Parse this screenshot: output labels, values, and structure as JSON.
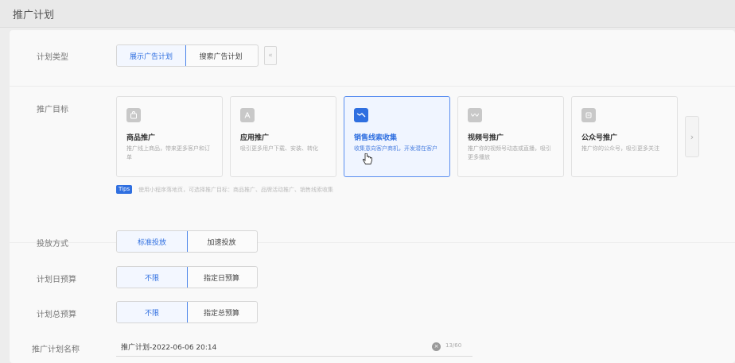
{
  "page": {
    "title": "推广计划"
  },
  "plan_type": {
    "label": "计划类型",
    "options": [
      "展示广告计划",
      "搜索广告计划"
    ],
    "selected": "展示广告计划",
    "collapse_glyph": "«"
  },
  "goal": {
    "label": "推广目标",
    "cards": [
      {
        "title": "商品推广",
        "desc": "推广线上商品，带来更多客户和订单",
        "icon": "shopping-bag-icon"
      },
      {
        "title": "应用推广",
        "desc": "吸引更多用户下载、安装、转化",
        "icon": "app-store-icon"
      },
      {
        "title": "销售线索收集",
        "desc": "收集意向客户商机，开发潜在客户",
        "icon": "sales-leads-icon"
      },
      {
        "title": "视频号推广",
        "desc": "推广你的视频号动态或直播，吸引更多播放",
        "icon": "video-channel-icon"
      },
      {
        "title": "公众号推广",
        "desc": "推广你的公众号，吸引更多关注",
        "icon": "official-account-icon"
      }
    ],
    "selected": "销售线索收集",
    "next_glyph": "›"
  },
  "tips": {
    "tag": "Tips",
    "text": "使用小程序落地页，可选择推广目标：商品推广、品牌活动推广、销售线索收集"
  },
  "delivery": {
    "label": "投放方式",
    "options": [
      "标准投放",
      "加速投放"
    ],
    "selected": "标准投放"
  },
  "daily_budget": {
    "label": "计划日预算",
    "options": [
      "不限",
      "指定日预算"
    ],
    "selected": "不限"
  },
  "total_budget": {
    "label": "计划总预算",
    "options": [
      "不限",
      "指定总预算"
    ],
    "selected": "不限"
  },
  "plan_name": {
    "label": "推广计划名称",
    "value": "推广计划-2022-06-06 20:14",
    "counter": "13/60",
    "clear_glyph": "×"
  },
  "colors": {
    "accent": "#2f6fe0",
    "page_bg": "#ededed",
    "card_bg": "#f9f9f9"
  }
}
